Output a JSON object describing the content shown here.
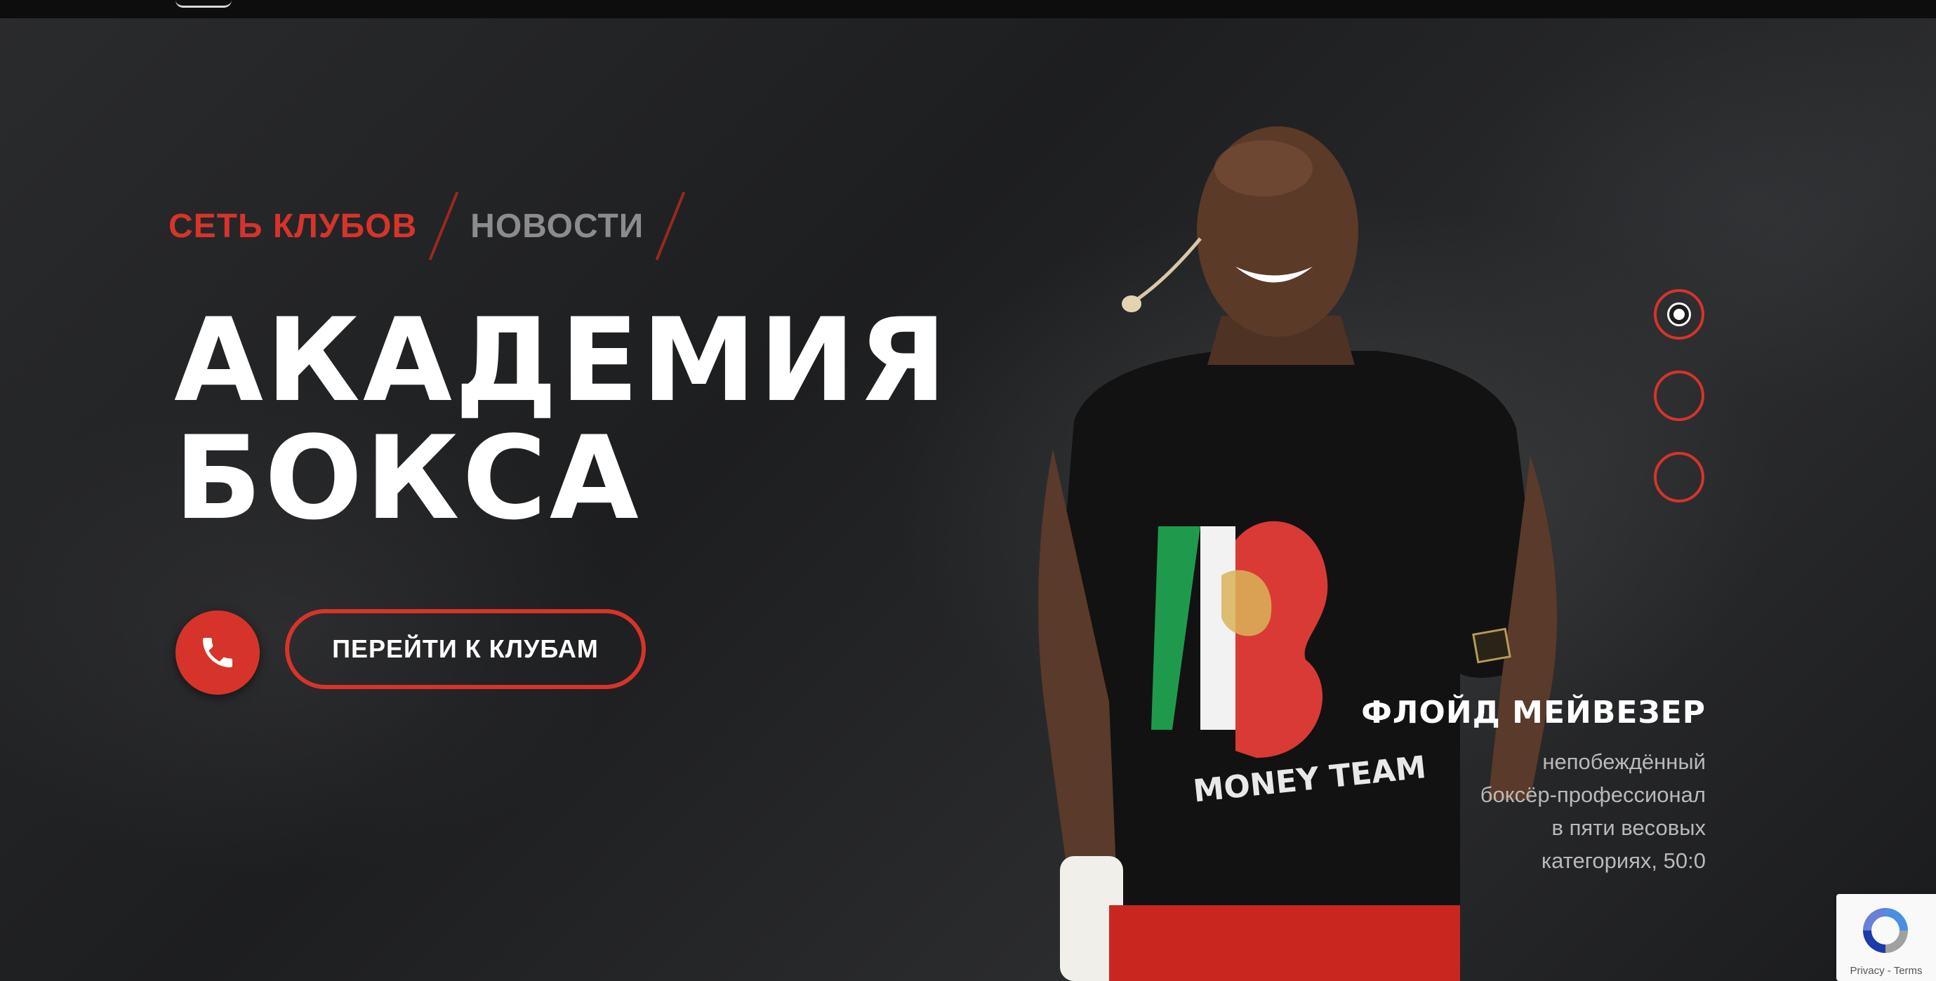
{
  "breadcrumb": {
    "clubs": "СЕТЬ КЛУБОВ",
    "news": "НОВОСТИ"
  },
  "hero": {
    "title_line1": "АКАДЕМИЯ",
    "title_line2": "БОКСА"
  },
  "actions": {
    "call_icon": "phone-icon",
    "clubs_button": "ПЕРЕЙТИ К КЛУБАМ"
  },
  "slider": {
    "count": 3,
    "active_index": 0
  },
  "person": {
    "name": "ФЛОЙД МЕЙВЕЗЕР",
    "desc_line1": "непобеждённый",
    "desc_line2": "боксёр-профессионал",
    "desc_line3": "в пяти весовых",
    "desc_line4": "категориях, 50:0"
  },
  "recaptcha": {
    "privacy": "Privacy",
    "separator": " - ",
    "terms": "Terms"
  },
  "colors": {
    "accent": "#d6342a",
    "text": "#ffffff",
    "muted": "#8c8c8c"
  }
}
